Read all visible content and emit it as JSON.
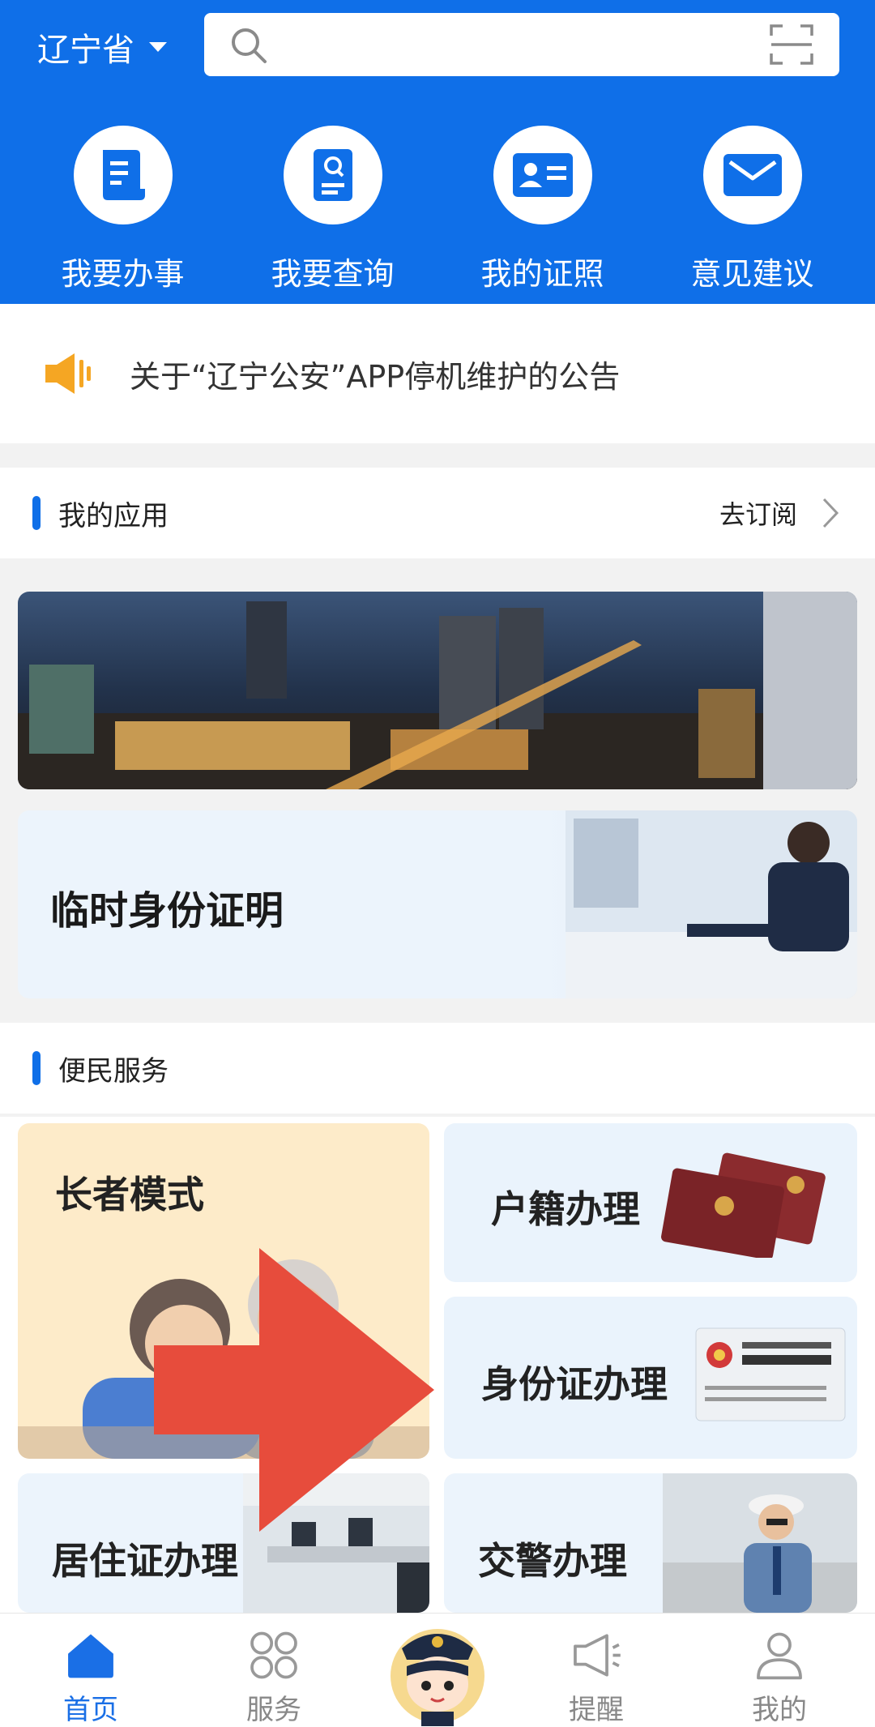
{
  "header": {
    "province": "辽宁省",
    "search": {
      "placeholder": ""
    },
    "quick_actions": [
      {
        "label": "我要办事",
        "icon": "document-icon"
      },
      {
        "label": "我要查询",
        "icon": "search-doc-icon"
      },
      {
        "label": "我的证照",
        "icon": "id-card-icon"
      },
      {
        "label": "意见建议",
        "icon": "mail-icon"
      }
    ]
  },
  "notice": {
    "text": "关于“辽宁公安”APP停机维护的公告",
    "icon": "speaker-icon"
  },
  "my_apps": {
    "title": "我的应用",
    "more_label": "去订阅"
  },
  "temp_card": {
    "title": "临时身份证明"
  },
  "services": {
    "title": "便民服务",
    "tiles": [
      {
        "label": "长者模式"
      },
      {
        "label": "户籍办理"
      },
      {
        "label": "身份证办理"
      },
      {
        "label": "居住证办理"
      },
      {
        "label": "交警办理"
      }
    ]
  },
  "bottom_nav": [
    {
      "label": "首页",
      "icon": "home-icon",
      "active": true
    },
    {
      "label": "服务",
      "icon": "grid-icon"
    },
    {
      "label": "",
      "icon": "police-mascot-icon"
    },
    {
      "label": "提醒",
      "icon": "megaphone-icon"
    },
    {
      "label": "我的",
      "icon": "person-icon"
    }
  ],
  "colors": {
    "primary": "#0f6fe8",
    "arrow": "#e74c3c",
    "elder_tile": "#fdebc9"
  }
}
